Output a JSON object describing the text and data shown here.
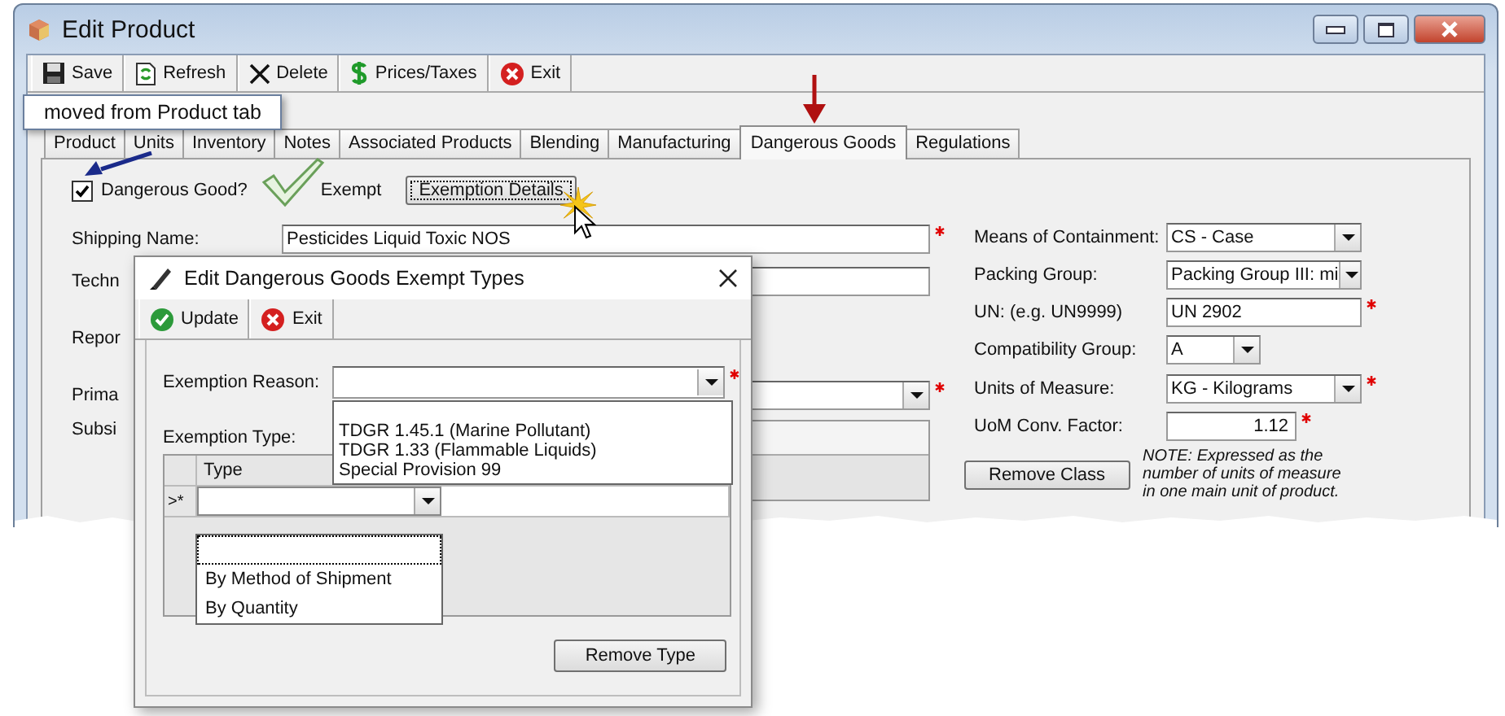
{
  "window": {
    "title": "Edit Product"
  },
  "toolbar": [
    {
      "kind": "save",
      "label": "Save"
    },
    {
      "kind": "refresh",
      "label": "Refresh"
    },
    {
      "kind": "delete",
      "label": "Delete"
    },
    {
      "kind": "prices",
      "label": "Prices/Taxes"
    },
    {
      "kind": "exit",
      "label": "Exit"
    }
  ],
  "callout": {
    "text": "moved from Product tab"
  },
  "tabs": [
    {
      "label": "Product",
      "selected": false
    },
    {
      "label": "Units",
      "selected": false
    },
    {
      "label": "Inventory",
      "selected": false
    },
    {
      "label": "Notes",
      "selected": false
    },
    {
      "label": "Associated Products",
      "selected": false
    },
    {
      "label": "Blending",
      "selected": false
    },
    {
      "label": "Manufacturing",
      "selected": false
    },
    {
      "label": "Dangerous Goods",
      "selected": true
    },
    {
      "label": "Regulations",
      "selected": false
    }
  ],
  "dangerous_good": {
    "label": "Dangerous Good?",
    "checked": true
  },
  "exempt": {
    "label": "Exempt"
  },
  "exemption_details_button": {
    "label": "Exemption Details"
  },
  "left_fields": [
    {
      "kind": "text",
      "label": "Shipping Name:",
      "value": "Pesticides Liquid Toxic NOS",
      "required": true
    },
    {
      "kind": "text",
      "label": "Techn",
      "required": false
    },
    {
      "kind": "none",
      "label": "Repor"
    },
    {
      "kind": "select",
      "label": "Prima",
      "required": true
    },
    {
      "kind": "grid",
      "label": "Subsi"
    }
  ],
  "right_fields": [
    {
      "kind": "select",
      "label": "Means of Containment:",
      "value": "CS - Case",
      "required": false
    },
    {
      "kind": "select",
      "label": "Packing Group:",
      "value": "Packing Group III: mi",
      "required": false
    },
    {
      "kind": "text",
      "label": "UN: (e.g. UN9999)",
      "value": "UN 2902",
      "required": true
    },
    {
      "kind": "short_select",
      "label": "Compatibility Group:",
      "value": "A",
      "required": false
    },
    {
      "kind": "select",
      "label": "Units of Measure:",
      "value": "KG - Kilograms",
      "required": true
    },
    {
      "kind": "number",
      "label": "UoM Conv. Factor:",
      "value": "1.12",
      "required": true
    }
  ],
  "note": "NOTE: Expressed as the number of units of measure in one main unit of product.",
  "remove_class_button": {
    "label": "Remove Class"
  },
  "dialog": {
    "title": "Edit Dangerous Goods Exempt Types",
    "toolbar": [
      {
        "kind": "update",
        "label": "Update"
      },
      {
        "kind": "exit",
        "label": "Exit"
      }
    ],
    "exemption_reason": {
      "label": "Exemption Reason:",
      "required": true,
      "options": [
        "TDGR 1.45.1 (Marine Pollutant)",
        "TDGR 1.33 (Flammable Liquids)",
        "Special Provision 99"
      ]
    },
    "exemption_type": {
      "label": "Exemption Type:",
      "columns": [
        "Type"
      ],
      "new_row_marker": ">*",
      "options": [
        "By Method of Shipment",
        "By Quantity"
      ]
    },
    "remove_type_button": {
      "label": "Remove Type"
    }
  }
}
